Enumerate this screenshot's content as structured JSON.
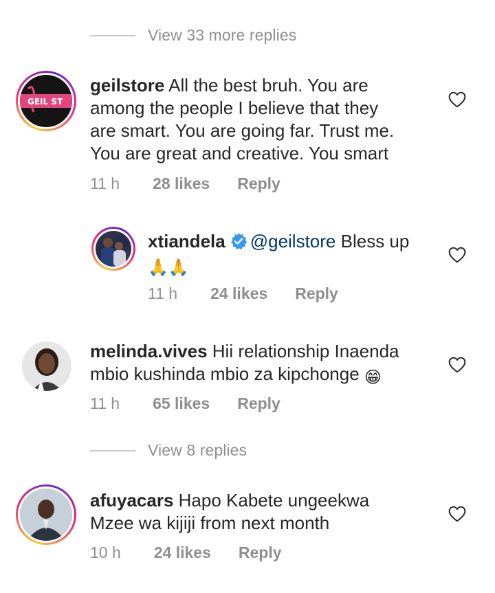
{
  "view_more_top": {
    "label": "View 33 more replies"
  },
  "view_more_mid": {
    "label": "View 8 replies"
  },
  "comments": [
    {
      "username": "geilstore",
      "text": "All the best bruh. You are among the people I believe that they are smart. You are going far. Trust me. You are great and creative. You smart",
      "lines": [
        "All the best bruh. You are",
        "among the people I believe that they",
        "are smart. You are going far. Trust me.",
        "You are great and creative. You smart"
      ],
      "time": "11 h",
      "likes": "28 likes",
      "reply": "Reply",
      "avatar_text": "GEIL ST"
    },
    {
      "username": "xtiandela",
      "mention": "@geilstore",
      "text": "Bless up",
      "emoji": "🙏🙏",
      "time": "11 h",
      "likes": "24 likes",
      "reply": "Reply"
    },
    {
      "username": "melinda.vives",
      "lines": [
        "Hii relationship Inaenda",
        "mbio kushinda mbio za kipchonge"
      ],
      "emoji": "😁",
      "time": "11 h",
      "likes": "65 likes",
      "reply": "Reply"
    },
    {
      "username": "afuyacars",
      "lines": [
        "Hapo Kabete ungeekwa",
        "Mzee wa kijiji from next month"
      ],
      "time": "10 h",
      "likes": "24 likes",
      "reply": "Reply"
    }
  ],
  "colors": {
    "text": "#262626",
    "secondary": "#8e8e8e",
    "mention": "#00376b",
    "verified": "#3897f0",
    "story_ring_start": "#f9ce34",
    "story_ring_mid": "#ee2a7b"
  },
  "icons": {
    "heart": "heart-outline-icon",
    "verified": "verified-badge-icon"
  }
}
